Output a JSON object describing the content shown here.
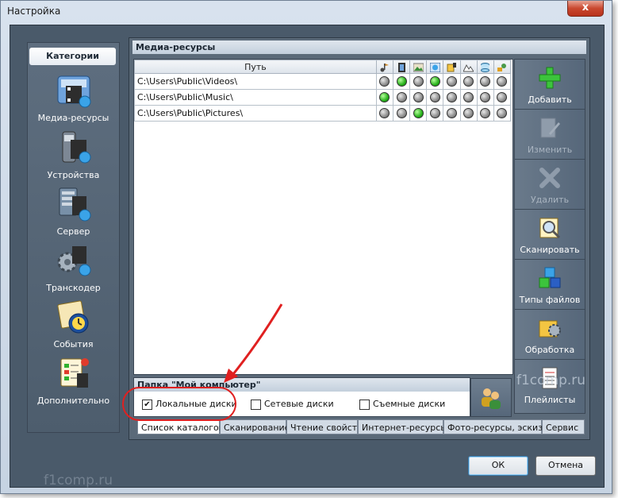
{
  "window": {
    "title": "Настройка",
    "close_glyph": "x"
  },
  "categories": {
    "header": "Категории",
    "items": [
      {
        "label": "Медиа-ресурсы",
        "icon": "media-resources-icon"
      },
      {
        "label": "Устройства",
        "icon": "devices-icon"
      },
      {
        "label": "Сервер",
        "icon": "server-icon"
      },
      {
        "label": "Транскодер",
        "icon": "transcoder-icon"
      },
      {
        "label": "События",
        "icon": "events-icon"
      },
      {
        "label": "Дополнительно",
        "icon": "additional-icon"
      }
    ]
  },
  "media": {
    "header": "Медиа-ресурсы",
    "path_column": "Путь",
    "type_columns": [
      "music-icon",
      "video-icon",
      "photo-icon",
      "internet-icon",
      "podcast-icon",
      "photo-scan-icon",
      "database-icon",
      "tools-icon"
    ],
    "rows": [
      {
        "path": "C:\\Users\\Public\\Videos\\",
        "flags": [
          false,
          true,
          false,
          true,
          false,
          false,
          false,
          false
        ]
      },
      {
        "path": "C:\\Users\\Public\\Music\\",
        "flags": [
          true,
          false,
          false,
          false,
          false,
          false,
          false,
          false
        ]
      },
      {
        "path": "C:\\Users\\Public\\Pictures\\",
        "flags": [
          false,
          false,
          true,
          false,
          false,
          false,
          false,
          false
        ]
      }
    ]
  },
  "toolbar": {
    "buttons": [
      {
        "label": "Добавить",
        "icon": "add-icon",
        "enabled": true
      },
      {
        "label": "Изменить",
        "icon": "edit-icon",
        "enabled": false
      },
      {
        "label": "Удалить",
        "icon": "delete-icon",
        "enabled": false
      },
      {
        "label": "Сканировать",
        "icon": "scan-icon",
        "enabled": true
      },
      {
        "label": "Типы файлов",
        "icon": "file-types-icon",
        "enabled": true
      },
      {
        "label": "Обработка",
        "icon": "processing-icon",
        "enabled": true
      },
      {
        "label": "Плейлисты",
        "icon": "playlists-icon",
        "enabled": true
      }
    ]
  },
  "folder": {
    "header": "Папка \"Мой компьютер\"",
    "options": [
      {
        "label": "Локальные диски",
        "checked": true
      },
      {
        "label": "Сетевые диски",
        "checked": false
      },
      {
        "label": "Съемные диски",
        "checked": false
      }
    ]
  },
  "tabs": [
    "Список каталогов",
    "Сканирование",
    "Чтение свойств",
    "Интернет-ресурсы",
    "Фото-ресурсы, эскизы",
    "Сервис"
  ],
  "active_tab": "Список каталогов",
  "buttons": {
    "ok": "ОК",
    "cancel": "Отмена"
  },
  "watermark": "f1comp.ru",
  "watermark_left": "f1comp.ru",
  "colors": {
    "annotation": "#e02020",
    "dot_on": "#27b01b",
    "dot_off": "#8d8d8d"
  }
}
